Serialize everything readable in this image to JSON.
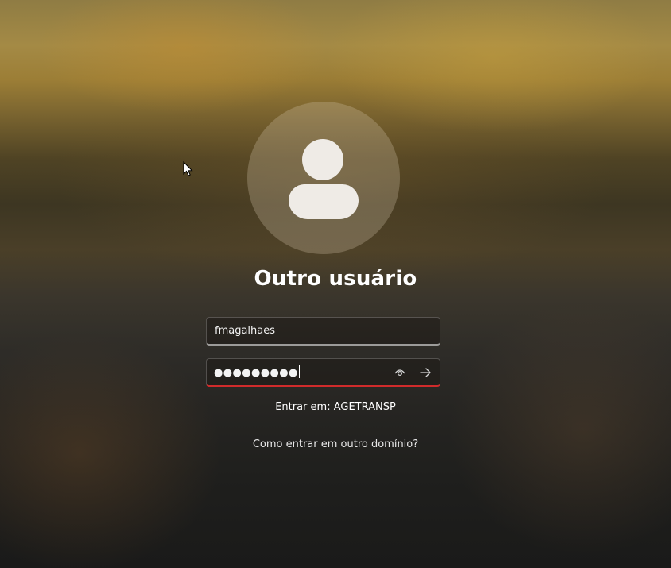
{
  "login": {
    "user_title": "Outro usuário",
    "username_value": "fmagalhaes",
    "password_mask": "●●●●●●●●●",
    "domain_line": "Entrar em: AGETRANSP",
    "other_domain_link": "Como entrar em outro domínio?"
  },
  "icons": {
    "avatar": "user-silhouette-icon",
    "reveal": "eye-icon",
    "submit": "arrow-right-icon",
    "cursor": "mouse-pointer-icon"
  },
  "colors": {
    "error_underline": "#d12b2b",
    "text": "#ffffff",
    "avatar_fill": "#efebe6"
  }
}
